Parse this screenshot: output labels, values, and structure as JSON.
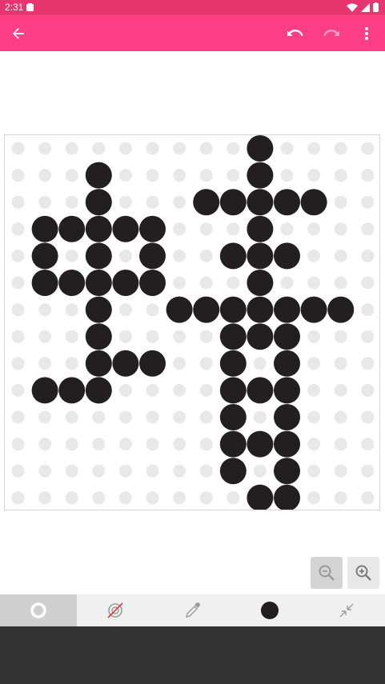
{
  "status": {
    "time": "2:31"
  },
  "appbar": {
    "back_icon": "arrow-back-icon",
    "undo_icon": "undo-icon",
    "redo_icon": "redo-icon",
    "menu_icon": "more-vert-icon"
  },
  "grid": {
    "cols": 14,
    "rows": 14,
    "filled_color": "#231f20",
    "empty_color": "#e8e8e8",
    "filled": [
      [
        0,
        9
      ],
      [
        1,
        3
      ],
      [
        1,
        9
      ],
      [
        2,
        3
      ],
      [
        2,
        7
      ],
      [
        2,
        8
      ],
      [
        2,
        9
      ],
      [
        2,
        10
      ],
      [
        2,
        11
      ],
      [
        3,
        1
      ],
      [
        3,
        2
      ],
      [
        3,
        3
      ],
      [
        3,
        4
      ],
      [
        3,
        5
      ],
      [
        3,
        9
      ],
      [
        4,
        1
      ],
      [
        4,
        3
      ],
      [
        4,
        5
      ],
      [
        4,
        8
      ],
      [
        4,
        9
      ],
      [
        4,
        10
      ],
      [
        5,
        1
      ],
      [
        5,
        2
      ],
      [
        5,
        3
      ],
      [
        5,
        4
      ],
      [
        5,
        5
      ],
      [
        5,
        9
      ],
      [
        6,
        3
      ],
      [
        6,
        6
      ],
      [
        6,
        7
      ],
      [
        6,
        8
      ],
      [
        6,
        9
      ],
      [
        6,
        10
      ],
      [
        6,
        11
      ],
      [
        6,
        12
      ],
      [
        7,
        3
      ],
      [
        7,
        8
      ],
      [
        7,
        9
      ],
      [
        7,
        10
      ],
      [
        8,
        3
      ],
      [
        8,
        4
      ],
      [
        8,
        5
      ],
      [
        8,
        8
      ],
      [
        8,
        10
      ],
      [
        9,
        1
      ],
      [
        9,
        2
      ],
      [
        9,
        3
      ],
      [
        9,
        8
      ],
      [
        9,
        9
      ],
      [
        9,
        10
      ],
      [
        10,
        8
      ],
      [
        10,
        10
      ],
      [
        11,
        8
      ],
      [
        11,
        9
      ],
      [
        11,
        10
      ],
      [
        12,
        8
      ],
      [
        12,
        10
      ],
      [
        13,
        9
      ],
      [
        13,
        10
      ]
    ]
  },
  "zoom": {
    "zoom_out_icon": "zoom-out-icon",
    "zoom_in_icon": "zoom-in-icon"
  },
  "toolbar": {
    "tools": [
      "brush-circle-icon",
      "eraser-icon",
      "eyedropper-icon",
      "color-swatch-icon",
      "collapse-icon"
    ],
    "active_tool": "brush-circle-icon",
    "current_color": "#231f20"
  },
  "colors": {
    "statusbar": "#e8346f",
    "appbar": "#ff3f85",
    "navbar": "#333333"
  }
}
